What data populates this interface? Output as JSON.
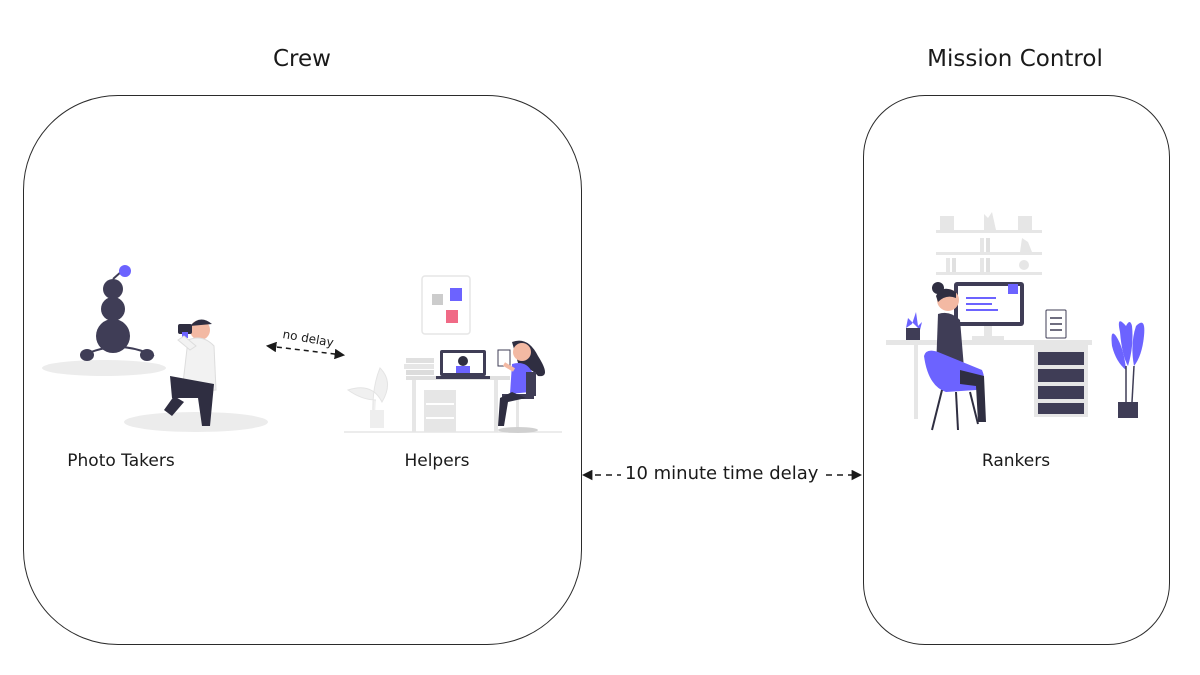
{
  "groups": {
    "crew": {
      "title": "Crew"
    },
    "mission_control": {
      "title": "Mission Control"
    }
  },
  "roles": {
    "photo_takers": "Photo Takers",
    "helpers": "Helpers",
    "rankers": "Rankers"
  },
  "links": {
    "crew_internal": "no delay",
    "crew_to_mission": "10 minute time delay"
  },
  "colors": {
    "accent": "#6c63ff",
    "dark": "#3f3d56",
    "pink": "#f06a86",
    "light_gray": "#e6e6e6",
    "outline": "#2b2b2b"
  }
}
